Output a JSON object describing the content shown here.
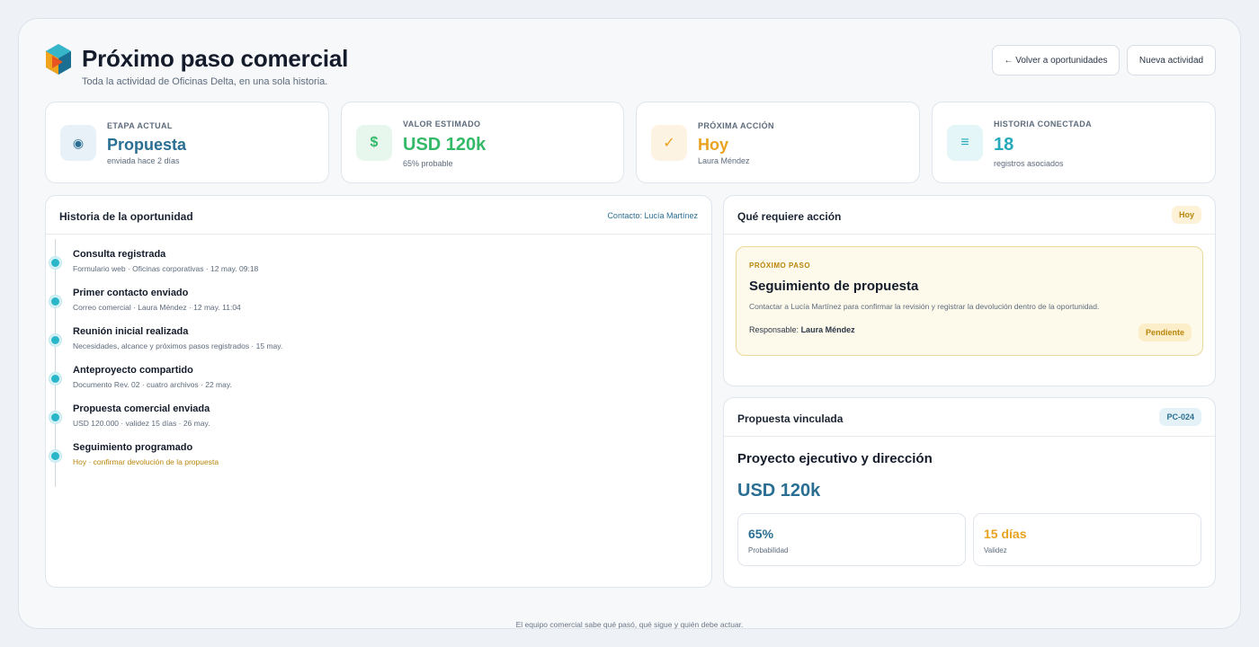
{
  "header": {
    "title": "Próximo paso comercial",
    "subtitle": "Toda la actividad de Oficinas Delta, en una sola historia.",
    "back_label": "← Volver a oportunidades",
    "new_label": "Nueva actividad"
  },
  "stats": [
    {
      "label": "ETAPA ACTUAL",
      "value": "Propuesta",
      "sub": "enviada hace 2 días",
      "icon": "target-icon",
      "glyph": "◉",
      "color": "#2a6f93",
      "bg": "#e8f1f7"
    },
    {
      "label": "VALOR ESTIMADO",
      "value": "USD 120k",
      "sub": "65% probable",
      "icon": "dollar-icon",
      "glyph": "$",
      "color": "#33b968",
      "bg": "#e7f7ee"
    },
    {
      "label": "PRÓXIMA ACCIÓN",
      "value": "Hoy",
      "sub": "Laura Méndez",
      "icon": "check-icon",
      "glyph": "✓",
      "color": "#e8a21e",
      "bg": "#fdf3e2"
    },
    {
      "label": "HISTORIA CONECTADA",
      "value": "18",
      "sub": "registros asociados",
      "icon": "list-icon",
      "glyph": "≡",
      "color": "#26a9ba",
      "bg": "#e4f6f8"
    }
  ],
  "history": {
    "title": "Historia de la oportunidad",
    "contact": "Contacto: Lucía Martínez",
    "items": [
      {
        "title": "Consulta registrada",
        "meta": "Formulario web · Oficinas corporativas · 12 may. 09:18"
      },
      {
        "title": "Primer contacto enviado",
        "meta": "Correo comercial · Laura Méndez · 12 may. 11:04"
      },
      {
        "title": "Reunión inicial realizada",
        "meta": "Necesidades, alcance y próximos pasos registrados · 15 may."
      },
      {
        "title": "Anteproyecto compartido",
        "meta": "Documento Rev. 02 · cuatro archivos · 22 may."
      },
      {
        "title": "Propuesta comercial enviada",
        "meta": "USD 120.000 · validez 15 días · 26 may."
      },
      {
        "title": "Seguimiento programado",
        "meta": "Hoy · confirmar devolución de la propuesta"
      }
    ]
  },
  "action": {
    "title": "Qué requiere acción",
    "badge": "Hoy",
    "kicker": "PRÓXIMO PASO",
    "heading": "Seguimiento de propuesta",
    "description": "Contactar a Lucía Martínez para confirmar la revisión y registrar la devolución dentro de la oportunidad.",
    "owner_label": "Responsable:",
    "owner": "Laura Méndez",
    "status": "Pendiente"
  },
  "proposal": {
    "title": "Propuesta vinculada",
    "code": "PC-024",
    "name": "Proyecto ejecutivo y dirección",
    "amount": "USD 120k",
    "metrics": [
      {
        "value": "65%",
        "label": "Probabilidad",
        "color": "#2a6f93"
      },
      {
        "value": "15 días",
        "label": "Validez",
        "color": "#e8a21e"
      }
    ]
  },
  "footer": "El equipo comercial sabe qué pasó, qué sigue y quién debe actuar."
}
